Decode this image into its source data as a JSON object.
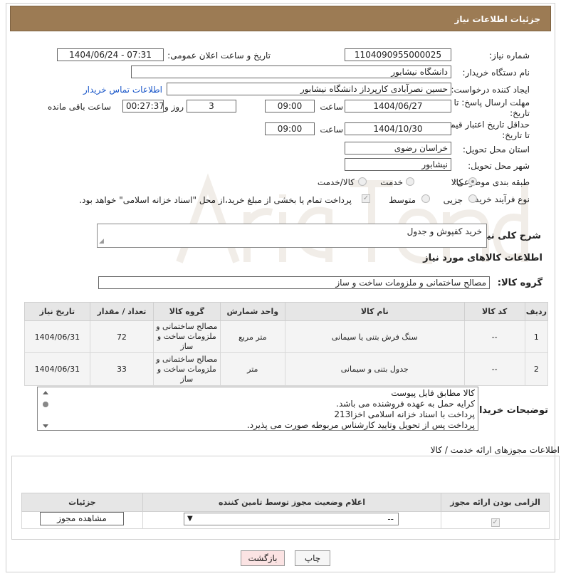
{
  "header": {
    "title": "جزئیات اطلاعات نیاز"
  },
  "fields": {
    "need_number_label": "شماره نیاز:",
    "need_number": "1104090955000025",
    "announce_label": "تاریخ و ساعت اعلان عمومی:",
    "announce_value": "1404/06/24 - 07:31",
    "buyer_org_label": "نام دستگاه خریدار:",
    "buyer_org": "دانشگاه نیشابور",
    "creator_label": "ایجاد کننده درخواست:",
    "creator": "حسین نصرآبادی کارپرداز دانشگاه نیشابور",
    "contact_link": "اطلاعات تماس خریدار",
    "deadline_label": "مهلت ارسال پاسخ: تا تاریخ:",
    "deadline_date": "1404/06/27",
    "time_label": "ساعت",
    "deadline_time": "09:00",
    "days_value": "3",
    "days_label": "روز و",
    "remaining_value": "00:27:37",
    "remaining_label": "ساعت باقی مانده",
    "price_validity_label": "حداقل تاریخ اعتبار قیمت: تا تاریخ:",
    "price_validity_date": "1404/10/30",
    "price_validity_time": "09:00",
    "province_label": "استان محل تحویل:",
    "province": "خراسان رضوی",
    "city_label": "شهر محل تحویل:",
    "city": "نیشابور",
    "category_label": "طبقه بندی موضوعی:",
    "category_options": [
      "کالا",
      "خدمت",
      "کالا/خدمت"
    ],
    "process_label": "نوع فرآیند خرید :",
    "process_options": [
      "جزیی",
      "متوسط"
    ],
    "payment_note": "پرداخت تمام یا بخشی از مبلغ خرید،از محل \"اسناد خزانه اسلامی\" خواهد بود.",
    "description_label": "شرح کلی نیاز:",
    "description": "خرید کفپوش و جدول"
  },
  "goods_section": {
    "title": "اطلاعات کالاهای مورد نیاز",
    "group_label": "گروه کالا:",
    "group_value": "مصالح ساختمانی و ملزومات ساخت و ساز"
  },
  "goods_table": {
    "columns": [
      "ردیف",
      "کد کالا",
      "نام کالا",
      "واحد شمارش",
      "گروه کالا",
      "تعداد / مقدار",
      "تاریخ نیاز"
    ],
    "rows": [
      [
        "1",
        "--",
        "سنگ فرش بتنی یا سیمانی",
        "متر مربع",
        "مصالح ساختمانی و ملزومات ساخت و ساز",
        "72",
        "1404/06/31"
      ],
      [
        "2",
        "--",
        "جدول بتنی و سیمانی",
        "متر",
        "مصالح ساختمانی و ملزومات ساخت و ساز",
        "33",
        "1404/06/31"
      ]
    ]
  },
  "buyer_notes": {
    "label": "توضیحات خریدار:",
    "lines": [
      "کالا مطابق فایل پیوست",
      "کرایه حمل به عهده فروشنده می باشد.",
      "پرداخت با اسناد خزانه اسلامی اخزا213",
      "پرداخت پس از تحویل وتایید کارشناس مربوطه صورت می پذیرد."
    ]
  },
  "license_section": {
    "title": "اطلاعات مجوزهای ارائه خدمت / کالا",
    "columns": [
      "الزامی بودن ارائه مجوز",
      "اعلام وضعیت مجوز توسط تامین کننده",
      "جزئیات"
    ],
    "select_value": "--",
    "view_button": "مشاهده مجوز"
  },
  "footer": {
    "print_button": "چاپ",
    "back_button": "بازگشت"
  },
  "colors": {
    "header": "#9c7b54",
    "link": "#1a57c9",
    "back_button_bg": "#fbe3e3"
  }
}
